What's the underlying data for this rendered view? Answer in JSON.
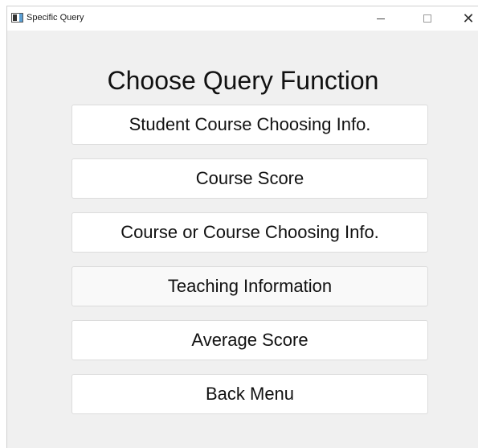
{
  "window": {
    "title": "Specific Query",
    "controls": {
      "minimize": "—",
      "maximize": "",
      "close": "✕"
    }
  },
  "main": {
    "heading": "Choose Query Function",
    "buttons": [
      {
        "label": "Student Course Choosing Info."
      },
      {
        "label": "Course Score"
      },
      {
        "label": "Course or Course Choosing Info."
      },
      {
        "label": "Teaching Information"
      },
      {
        "label": "Average Score"
      },
      {
        "label": "Back Menu"
      }
    ]
  }
}
